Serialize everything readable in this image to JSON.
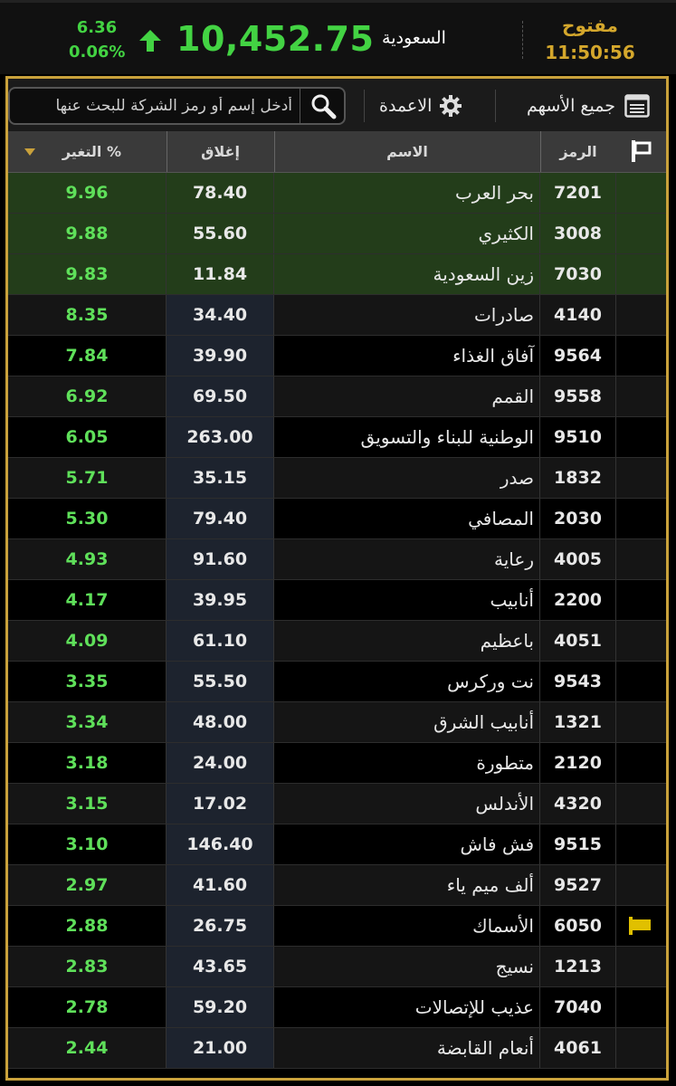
{
  "header": {
    "status_label": "مفتوح",
    "time": "11:50:56",
    "market": "السعودية",
    "index_value": "10,452.75",
    "change_points": "6.36",
    "change_percent": "0.06%",
    "up_color": "#43d343",
    "status_color": "#d4a72c"
  },
  "toolbar": {
    "all_stocks_label": "جميع الأسهم",
    "all_stocks_icon": "list-icon",
    "columns_label": "الاعمدة",
    "columns_icon": "gear-icon",
    "search_placeholder": "أدخل إسم أو رمز الشركة للبحث عنها",
    "search_icon": "search-icon"
  },
  "table": {
    "columns": {
      "code": "الرمز",
      "name": "الاسم",
      "close": "إغلاق",
      "change": "التغير %"
    },
    "sort_indicator": "sort-desc-icon",
    "rows": [
      {
        "code": "7201",
        "name": "بحر العرب",
        "close": "78.40",
        "change": "9.96",
        "highlight": true,
        "flag": false
      },
      {
        "code": "3008",
        "name": "الكثيري",
        "close": "55.60",
        "change": "9.88",
        "highlight": true,
        "flag": false
      },
      {
        "code": "7030",
        "name": "زين السعودية",
        "close": "11.84",
        "change": "9.83",
        "highlight": true,
        "flag": false
      },
      {
        "code": "4140",
        "name": "صادرات",
        "close": "34.40",
        "change": "8.35",
        "highlight": false,
        "flag": false
      },
      {
        "code": "9564",
        "name": "آفاق الغذاء",
        "close": "39.90",
        "change": "7.84",
        "highlight": false,
        "flag": false
      },
      {
        "code": "9558",
        "name": "القمم",
        "close": "69.50",
        "change": "6.92",
        "highlight": false,
        "flag": false
      },
      {
        "code": "9510",
        "name": "الوطنية للبناء والتسويق",
        "close": "263.00",
        "change": "6.05",
        "highlight": false,
        "flag": false
      },
      {
        "code": "1832",
        "name": "صدر",
        "close": "35.15",
        "change": "5.71",
        "highlight": false,
        "flag": false
      },
      {
        "code": "2030",
        "name": "المصافي",
        "close": "79.40",
        "change": "5.30",
        "highlight": false,
        "flag": false
      },
      {
        "code": "4005",
        "name": "رعاية",
        "close": "91.60",
        "change": "4.93",
        "highlight": false,
        "flag": false
      },
      {
        "code": "2200",
        "name": "أنابيب",
        "close": "39.95",
        "change": "4.17",
        "highlight": false,
        "flag": false
      },
      {
        "code": "4051",
        "name": "باعظيم",
        "close": "61.10",
        "change": "4.09",
        "highlight": false,
        "flag": false
      },
      {
        "code": "9543",
        "name": "نت وركرس",
        "close": "55.50",
        "change": "3.35",
        "highlight": false,
        "flag": false
      },
      {
        "code": "1321",
        "name": "أنابيب الشرق",
        "close": "48.00",
        "change": "3.34",
        "highlight": false,
        "flag": false
      },
      {
        "code": "2120",
        "name": "متطورة",
        "close": "24.00",
        "change": "3.18",
        "highlight": false,
        "flag": false
      },
      {
        "code": "4320",
        "name": "الأندلس",
        "close": "17.02",
        "change": "3.15",
        "highlight": false,
        "flag": false
      },
      {
        "code": "9515",
        "name": "فش فاش",
        "close": "146.40",
        "change": "3.10",
        "highlight": false,
        "flag": false
      },
      {
        "code": "9527",
        "name": "ألف ميم ياء",
        "close": "41.60",
        "change": "2.97",
        "highlight": false,
        "flag": false
      },
      {
        "code": "6050",
        "name": "الأسماك",
        "close": "26.75",
        "change": "2.88",
        "highlight": false,
        "flag": true
      },
      {
        "code": "1213",
        "name": "نسيج",
        "close": "43.65",
        "change": "2.83",
        "highlight": false,
        "flag": false
      },
      {
        "code": "7040",
        "name": "عذيب للإتصالات",
        "close": "59.20",
        "change": "2.78",
        "highlight": false,
        "flag": false
      },
      {
        "code": "4061",
        "name": "أنعام القابضة",
        "close": "21.00",
        "change": "2.44",
        "highlight": false,
        "flag": false
      }
    ]
  }
}
